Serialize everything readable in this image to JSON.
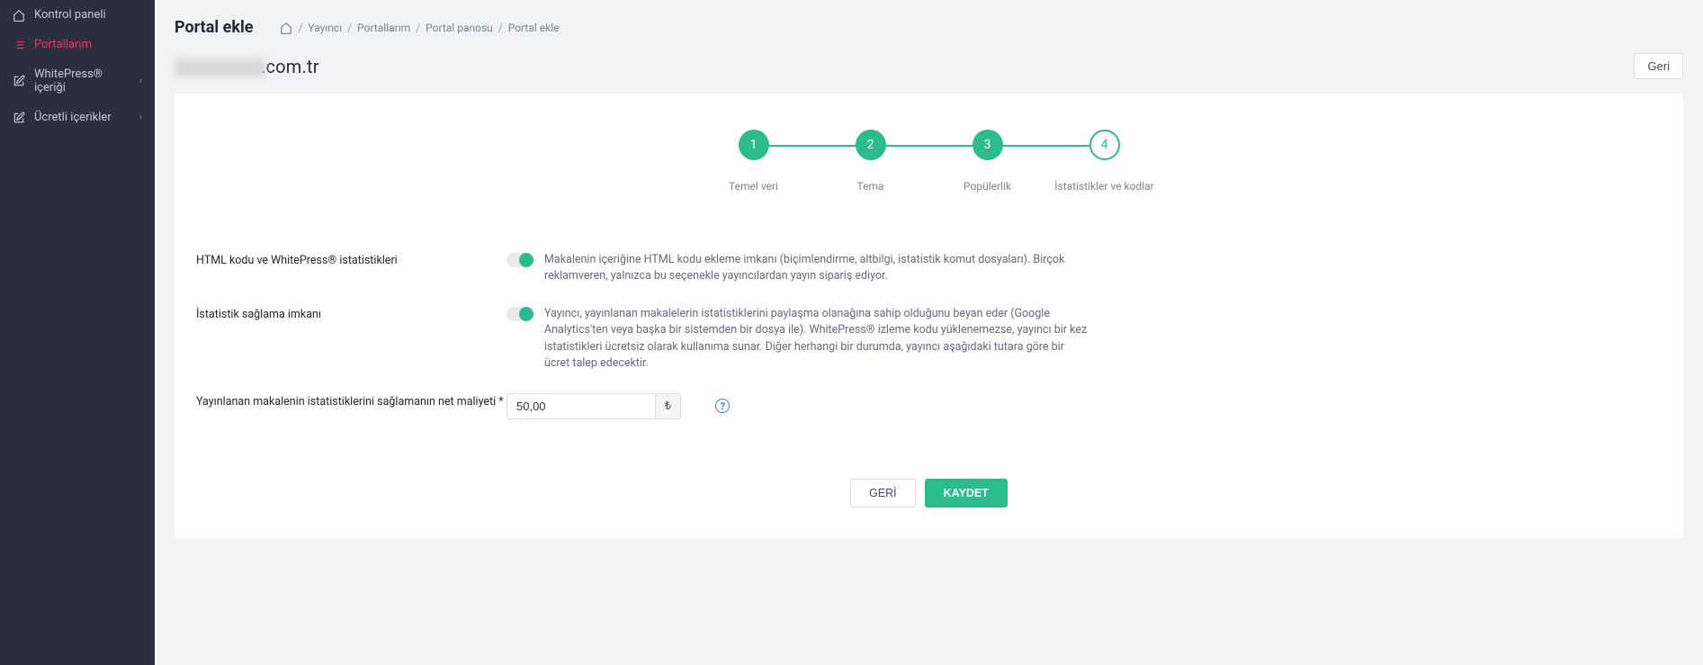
{
  "sidebar": {
    "items": [
      {
        "label": "Kontrol paneli",
        "icon": "home",
        "active": false,
        "chevron": false
      },
      {
        "label": "Portallarım",
        "icon": "list",
        "active": true,
        "chevron": false
      },
      {
        "label": "WhitePress® içeriği",
        "icon": "edit",
        "active": false,
        "chevron": true
      },
      {
        "label": "Ücretli içerikler",
        "icon": "edit",
        "active": false,
        "chevron": true
      }
    ]
  },
  "header": {
    "title": "Portal ekle",
    "breadcrumb": [
      "Yayıncı",
      "Portallarım",
      "Portal panosu",
      "Portal ekle"
    ],
    "domain_suffix": ".com.tr",
    "back_button": "Geri"
  },
  "stepper": {
    "steps": [
      {
        "num": "1",
        "label": "Temel veri",
        "state": "done"
      },
      {
        "num": "2",
        "label": "Tema",
        "state": "done"
      },
      {
        "num": "3",
        "label": "Popülerlik",
        "state": "done"
      },
      {
        "num": "4",
        "label": "İstatistikler ve kodlar",
        "state": "current"
      }
    ]
  },
  "form": {
    "row1": {
      "label": "HTML kodu ve WhitePress® istatistikleri",
      "desc": "Makalenin içeriğine HTML kodu ekleme imkanı (biçimlendirme, altbilgi, istatistik komut dosyaları). Birçok reklamveren, yalnızca bu seçenekle yayıncılardan yayın sipariş ediyor."
    },
    "row2": {
      "label": "İstatistik sağlama imkanı",
      "desc": "Yayıncı, yayınlanan makalelerin istatistiklerini paylaşma olanağına sahip olduğunu beyan eder (Google Analytics'ten veya başka bir sistemden bir dosya ile). WhitePress® izleme kodu yüklenemezse, yayıncı bir kez istatistikleri ücretsiz olarak kullanıma sunar. Diğer herhangi bir durumda, yayıncı aşağıdaki tutara göre bir ücret talep edecektir."
    },
    "row3": {
      "label": "Yayınlanan makalenin istatistiklerini sağlamanın net maliyeti *",
      "value": "50,00",
      "currency": "₺"
    }
  },
  "actions": {
    "back": "GERİ",
    "save": "KAYDET"
  }
}
